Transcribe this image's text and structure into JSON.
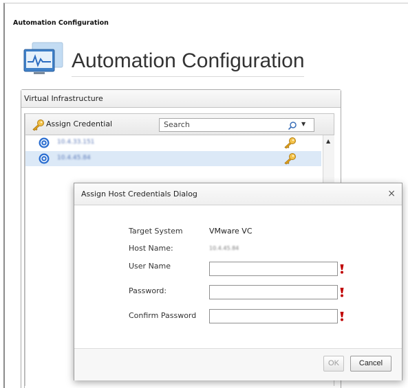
{
  "window": {
    "title": "Automation Configuration"
  },
  "app": {
    "heading": "Automation Configuration",
    "logo_icon": "monitor-heartbeat-icon"
  },
  "panel": {
    "title": "Virtual Infrastructure"
  },
  "toolbar": {
    "assign_label": "Assign Credential",
    "search_placeholder": "Search",
    "search_icon": "search-icon",
    "dropdown_icon": "chevron-down-icon"
  },
  "hosts": [
    {
      "address": "10.4.33.151",
      "selected": false,
      "icon": "host-icon",
      "credential_icon": "key-icon"
    },
    {
      "address": "10.4.45.84",
      "selected": true,
      "icon": "host-icon",
      "credential_icon": "key-icon"
    }
  ],
  "dialog": {
    "title": "Assign Host Credentials Dialog",
    "close_glyph": "×",
    "target_system_label": "Target System",
    "target_system_value": "VMware VC",
    "host_name_label": "Host Name:",
    "host_name_value": "10.4.45.84",
    "user_name_label": "User Name",
    "user_name_value": "",
    "password_label": "Password:",
    "password_value": "",
    "confirm_password_label": "Confirm Password",
    "confirm_password_value": "",
    "ok_label": "OK",
    "cancel_label": "Cancel"
  },
  "colors": {
    "selection": "#dce9f7",
    "required": "#c00000",
    "key_gold": "#e2a41c",
    "host_blue": "#2c6fd1"
  }
}
